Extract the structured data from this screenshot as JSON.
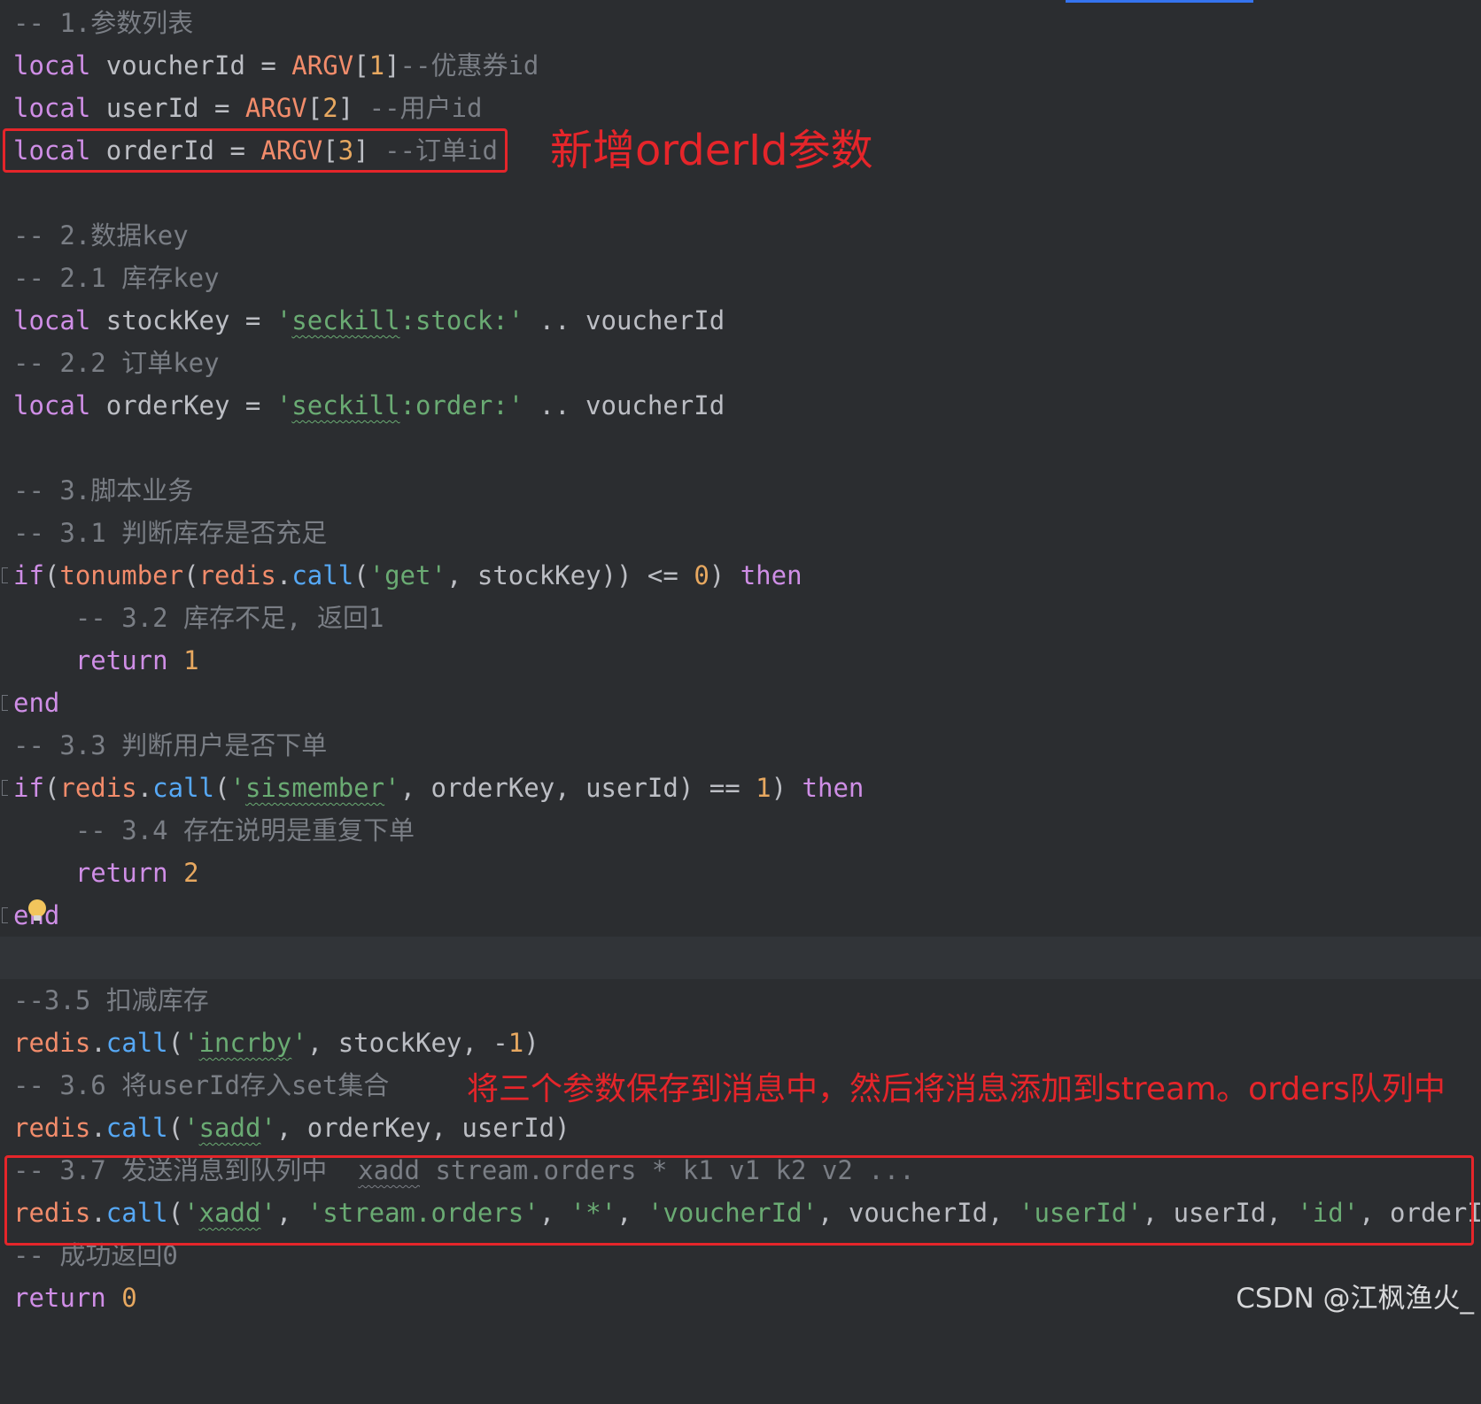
{
  "editor": {
    "lines": {
      "l1": {
        "c": "-- 1.参数列表"
      },
      "l2": {
        "k": "local",
        "v": " voucherId = ",
        "g": "ARGV",
        "b1": "[",
        "n": "1",
        "b2": "]",
        "c": "--优惠券id"
      },
      "l3": {
        "k": "local",
        "v": " userId = ",
        "g": "ARGV",
        "b1": "[",
        "n": "2",
        "b2": "] ",
        "c": "--用户id"
      },
      "l4": {
        "k": "local",
        "v": " orderId = ",
        "g": "ARGV",
        "b1": "[",
        "n": "3",
        "b2": "] ",
        "c": "--订单id"
      },
      "l6": {
        "c": "-- 2.数据key"
      },
      "l7": {
        "c": "-- 2.1 库存key"
      },
      "l8": {
        "k": "local",
        "v": " stockKey = ",
        "s1": "'",
        "s2": "seckill",
        "s3": ":stock:'",
        "v2": " .. voucherId"
      },
      "l9": {
        "c": "-- 2.2 订单key"
      },
      "l10": {
        "k": "local",
        "v": " orderKey = ",
        "s1": "'",
        "s2": "seckill",
        "s3": ":order:'",
        "v2": " .. voucherId"
      },
      "l12": {
        "c": "-- 3.脚本业务"
      },
      "l13": {
        "c": "-- 3.1 判断库存是否充足"
      },
      "l14": {
        "k": "if",
        "p1": "(",
        "g": "tonumber",
        "p2": "(",
        "g2": "redis",
        "d": ".",
        "f": "call",
        "p3": "(",
        "s": "'get'",
        "v": ", stockKey)) <= ",
        "n": "0",
        "p4": ") ",
        "k2": "then"
      },
      "l15": {
        "c": "    -- 3.2 库存不足, 返回1"
      },
      "l16": {
        "k": "    return",
        "sp": " ",
        "n": "1"
      },
      "l17": {
        "k": "end"
      },
      "l18": {
        "c": "-- 3.3 判断用户是否下单"
      },
      "l19": {
        "k": "if",
        "p1": "(",
        "g": "redis",
        "d": ".",
        "f": "call",
        "p2": "(",
        "s1": "'",
        "s2": "sismember",
        "s3": "'",
        "v": ", orderKey, userId) == ",
        "n": "1",
        "p3": ") ",
        "k2": "then"
      },
      "l20": {
        "c": "    -- 3.4 存在说明是重复下单"
      },
      "l21": {
        "k": "    return",
        "sp": " ",
        "n": "2"
      },
      "l22": {
        "k": "end"
      },
      "l24": {
        "c": "--3.5 扣减库存"
      },
      "l25": {
        "g": "redis",
        "d": ".",
        "f": "call",
        "p1": "(",
        "s1": "'",
        "s2": "incrby",
        "s3": "'",
        "v": ", stockKey, -",
        "n": "1",
        "p2": ")"
      },
      "l26": {
        "c": "-- 3.6 将userId存入set集合"
      },
      "l27": {
        "g": "redis",
        "d": ".",
        "f": "call",
        "p1": "(",
        "s1": "'",
        "s2": "sadd",
        "s3": "'",
        "v": ", orderKey, userId)"
      },
      "l28": {
        "c1": "-- 3.7 发送消息到队列中  ",
        "c2": "xadd",
        "c3": " stream.orders * k1 v1 k2 v2 ..."
      },
      "l29": {
        "g": "redis",
        "d": ".",
        "f": "call",
        "p1": "(",
        "s1": "'",
        "s2": "xadd",
        "s3": "'",
        "v1": ", ",
        "s4": "'stream.orders'",
        "v2": ", ",
        "s5": "'*'",
        "v3": ", ",
        "s6": "'voucherId'",
        "v4": ", voucherId, ",
        "s7": "'userId'",
        "v5": ", userId, ",
        "s8": "'id'",
        "v6": ", orderId)"
      },
      "l30": {
        "c": "-- 成功返回0"
      },
      "l31": {
        "k": "return",
        "sp": " ",
        "n": "0"
      }
    }
  },
  "annotations": {
    "top": "新增orderId参数",
    "bottom": "将三个参数保存到消息中，然后将消息添加到stream。orders队列中"
  },
  "watermark": "CSDN @江枫渔火_",
  "colors": {
    "background": "#2b2d30",
    "keyword": "#cf8ee6",
    "string": "#6aab73",
    "number": "#e7a860",
    "global": "#f28c6b",
    "function": "#56a8f5",
    "comment": "#7a7e85",
    "annotation": "#e5252a"
  }
}
